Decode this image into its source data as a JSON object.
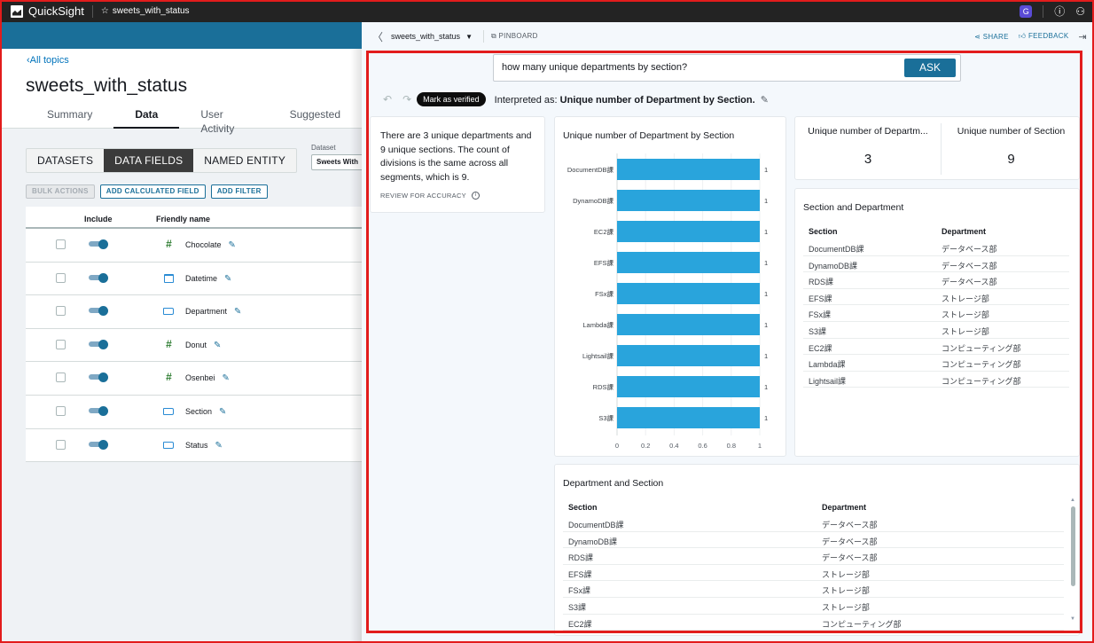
{
  "topbar": {
    "app_name": "QuickSight",
    "favorite_title": "sweets_with_status",
    "icons": [
      "extension-icon",
      "help-icon",
      "user-icon"
    ]
  },
  "left": {
    "back_link": "All topics",
    "title": "sweets_with_status",
    "tabs": [
      {
        "label": "Summary",
        "active": false
      },
      {
        "label": "Data",
        "active": true
      },
      {
        "label": "User Activity",
        "active": false
      },
      {
        "label": "Suggested",
        "active": false
      }
    ],
    "segments": [
      {
        "label": "DATASETS",
        "active": false
      },
      {
        "label": "DATA FIELDS",
        "active": true
      },
      {
        "label": "NAMED ENTITY",
        "active": false
      }
    ],
    "dataset_label": "Dataset",
    "dataset_value": "Sweets With",
    "actions": {
      "bulk": "BULK ACTIONS",
      "add_calc": "ADD CALCULATED FIELD",
      "add_filter": "ADD FILTER"
    },
    "table_headers": {
      "include": "Include",
      "friendly_name": "Friendly name"
    },
    "fields": [
      {
        "name": "Chocolate",
        "type": "number",
        "included": true
      },
      {
        "name": "Datetime",
        "type": "date",
        "included": true
      },
      {
        "name": "Department",
        "type": "dimension",
        "included": true
      },
      {
        "name": "Donut",
        "type": "number",
        "included": true
      },
      {
        "name": "Osenbei",
        "type": "number",
        "included": true
      },
      {
        "name": "Section",
        "type": "dimension",
        "included": true
      },
      {
        "name": "Status",
        "type": "dimension",
        "included": true
      }
    ]
  },
  "qpanel": {
    "topic": "sweets_with_status",
    "pinboard": "PINBOARD",
    "share": "SHARE",
    "feedback": "FEEDBACK",
    "question": "how many unique departments by section?",
    "ask": "ASK",
    "mark_verified": "Mark as verified",
    "interpreted_prefix": "Interpreted as:",
    "interpreted_value": "Unique number of Department by Section.",
    "narrative": "There are 3 unique departments and 9 unique sections. The count of divisions is the same across all segments, which is 9.",
    "review": "REVIEW FOR ACCURACY",
    "kpis": [
      {
        "label": "Unique number of Departm...",
        "value": "3"
      },
      {
        "label": "Unique number of Section",
        "value": "9"
      }
    ],
    "table1": {
      "title": "Section and Department",
      "headers": [
        "Section",
        "Department"
      ],
      "rows": [
        [
          "DocumentDB課",
          "データベース部"
        ],
        [
          "DynamoDB課",
          "データベース部"
        ],
        [
          "RDS課",
          "データベース部"
        ],
        [
          "EFS課",
          "ストレージ部"
        ],
        [
          "FSx課",
          "ストレージ部"
        ],
        [
          "S3課",
          "ストレージ部"
        ],
        [
          "EC2課",
          "コンピューティング部"
        ],
        [
          "Lambda課",
          "コンピューティング部"
        ],
        [
          "Lightsail課",
          "コンピューティング部"
        ]
      ]
    },
    "table2": {
      "title": "Department and Section",
      "headers": [
        "Section",
        "Department"
      ],
      "rows": [
        [
          "DocumentDB課",
          "データベース部"
        ],
        [
          "DynamoDB課",
          "データベース部"
        ],
        [
          "RDS課",
          "データベース部"
        ],
        [
          "EFS課",
          "ストレージ部"
        ],
        [
          "FSx課",
          "ストレージ部"
        ],
        [
          "S3課",
          "ストレージ部"
        ],
        [
          "EC2課",
          "コンピューティング部"
        ]
      ]
    }
  },
  "chart_data": {
    "type": "bar",
    "orientation": "horizontal",
    "title": "Unique number of Department by Section",
    "categories": [
      "DocumentDB課",
      "DynamoDB課",
      "EC2課",
      "EFS課",
      "FSx課",
      "Lambda課",
      "Lightsail課",
      "RDS課",
      "S3課"
    ],
    "values": [
      1,
      1,
      1,
      1,
      1,
      1,
      1,
      1,
      1
    ],
    "xlabel": "",
    "ylabel": "",
    "xlim": [
      0,
      1
    ],
    "xticks": [
      "0",
      "0.2",
      "0.4",
      "0.6",
      "0.8",
      "1"
    ],
    "data_labels": true,
    "grid": true,
    "color": "#29a4dc"
  }
}
